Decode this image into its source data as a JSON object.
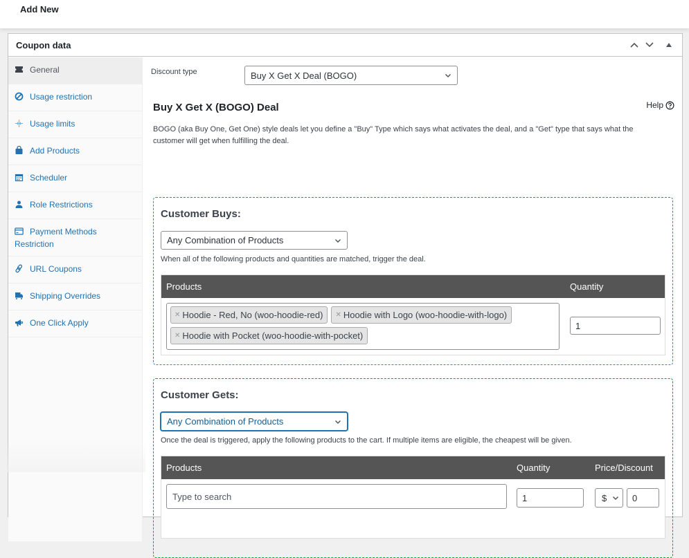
{
  "page": {
    "title": "Add New"
  },
  "postbox": {
    "title": "Coupon data",
    "actions": [
      {
        "name": "move-up",
        "icon": "chevron-up-icon"
      },
      {
        "name": "move-down",
        "icon": "chevron-down-icon"
      },
      {
        "name": "toggle",
        "icon": "triangle-up-icon"
      }
    ]
  },
  "sidebar": {
    "items": [
      {
        "label": "General",
        "icon": "ticket-icon",
        "active": true
      },
      {
        "label": "Usage restriction",
        "icon": "block-icon"
      },
      {
        "label": "Usage limits",
        "icon": "limits-icon"
      },
      {
        "label": "Add Products",
        "icon": "shopping-bag-icon"
      },
      {
        "label": "Scheduler",
        "icon": "calendar-icon"
      },
      {
        "label": "Role Restrictions",
        "icon": "user-icon"
      },
      {
        "label": "Payment Methods Restriction",
        "icon": "credit-card-icon"
      },
      {
        "label": "URL Coupons",
        "icon": "link-icon"
      },
      {
        "label": "Shipping Overrides",
        "icon": "truck-icon"
      },
      {
        "label": "One Click Apply",
        "icon": "megaphone-icon"
      }
    ]
  },
  "general": {
    "discount_type_label": "Discount type",
    "discount_type_value": "Buy X Get X Deal (BOGO)",
    "deal_title": "Buy X Get X (BOGO) Deal",
    "help_label": "Help",
    "description": "BOGO (aka Buy One, Get One) style deals let you define a \"Buy\" Type which says what activates the deal, and a \"Get\" type that says what the customer will get when fulfilling the deal."
  },
  "customer_buys": {
    "heading": "Customer Buys:",
    "type_value": "Any Combination of Products",
    "note": "When all of the following products and quantities are matched, trigger the deal.",
    "columns": [
      "Products",
      "Quantity"
    ],
    "products": [
      "Hoodie - Red, No (woo-hoodie-red)",
      "Hoodie with Logo (woo-hoodie-with-logo)",
      "Hoodie with Pocket (woo-hoodie-with-pocket)"
    ],
    "quantity": "1"
  },
  "customer_gets": {
    "heading": "Customer Gets:",
    "type_value": "Any Combination of Products",
    "note": "Once the deal is triggered, apply the following products to the cart. If multiple items are eligible, the cheapest will be given.",
    "columns": [
      "Products",
      "Quantity",
      "Price/Discount"
    ],
    "search_placeholder": "Type to search",
    "quantity": "1",
    "discount_type": "$",
    "discount_value": "0"
  },
  "colors": {
    "link": "#2271b1",
    "buys_border": "#1e8cbe",
    "gets_border": "#00a32a",
    "table_header": "#555555"
  }
}
